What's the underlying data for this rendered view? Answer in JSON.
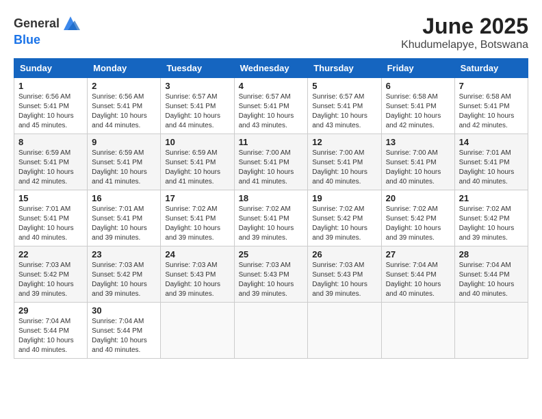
{
  "header": {
    "logo_general": "General",
    "logo_blue": "Blue",
    "month_title": "June 2025",
    "location": "Khudumelapye, Botswana"
  },
  "columns": [
    "Sunday",
    "Monday",
    "Tuesday",
    "Wednesday",
    "Thursday",
    "Friday",
    "Saturday"
  ],
  "weeks": [
    [
      {
        "day": "1",
        "sunrise": "6:56 AM",
        "sunset": "5:41 PM",
        "daylight": "10 hours and 45 minutes."
      },
      {
        "day": "2",
        "sunrise": "6:56 AM",
        "sunset": "5:41 PM",
        "daylight": "10 hours and 44 minutes."
      },
      {
        "day": "3",
        "sunrise": "6:57 AM",
        "sunset": "5:41 PM",
        "daylight": "10 hours and 44 minutes."
      },
      {
        "day": "4",
        "sunrise": "6:57 AM",
        "sunset": "5:41 PM",
        "daylight": "10 hours and 43 minutes."
      },
      {
        "day": "5",
        "sunrise": "6:57 AM",
        "sunset": "5:41 PM",
        "daylight": "10 hours and 43 minutes."
      },
      {
        "day": "6",
        "sunrise": "6:58 AM",
        "sunset": "5:41 PM",
        "daylight": "10 hours and 42 minutes."
      },
      {
        "day": "7",
        "sunrise": "6:58 AM",
        "sunset": "5:41 PM",
        "daylight": "10 hours and 42 minutes."
      }
    ],
    [
      {
        "day": "8",
        "sunrise": "6:59 AM",
        "sunset": "5:41 PM",
        "daylight": "10 hours and 42 minutes."
      },
      {
        "day": "9",
        "sunrise": "6:59 AM",
        "sunset": "5:41 PM",
        "daylight": "10 hours and 41 minutes."
      },
      {
        "day": "10",
        "sunrise": "6:59 AM",
        "sunset": "5:41 PM",
        "daylight": "10 hours and 41 minutes."
      },
      {
        "day": "11",
        "sunrise": "7:00 AM",
        "sunset": "5:41 PM",
        "daylight": "10 hours and 41 minutes."
      },
      {
        "day": "12",
        "sunrise": "7:00 AM",
        "sunset": "5:41 PM",
        "daylight": "10 hours and 40 minutes."
      },
      {
        "day": "13",
        "sunrise": "7:00 AM",
        "sunset": "5:41 PM",
        "daylight": "10 hours and 40 minutes."
      },
      {
        "day": "14",
        "sunrise": "7:01 AM",
        "sunset": "5:41 PM",
        "daylight": "10 hours and 40 minutes."
      }
    ],
    [
      {
        "day": "15",
        "sunrise": "7:01 AM",
        "sunset": "5:41 PM",
        "daylight": "10 hours and 40 minutes."
      },
      {
        "day": "16",
        "sunrise": "7:01 AM",
        "sunset": "5:41 PM",
        "daylight": "10 hours and 39 minutes."
      },
      {
        "day": "17",
        "sunrise": "7:02 AM",
        "sunset": "5:41 PM",
        "daylight": "10 hours and 39 minutes."
      },
      {
        "day": "18",
        "sunrise": "7:02 AM",
        "sunset": "5:41 PM",
        "daylight": "10 hours and 39 minutes."
      },
      {
        "day": "19",
        "sunrise": "7:02 AM",
        "sunset": "5:42 PM",
        "daylight": "10 hours and 39 minutes."
      },
      {
        "day": "20",
        "sunrise": "7:02 AM",
        "sunset": "5:42 PM",
        "daylight": "10 hours and 39 minutes."
      },
      {
        "day": "21",
        "sunrise": "7:02 AM",
        "sunset": "5:42 PM",
        "daylight": "10 hours and 39 minutes."
      }
    ],
    [
      {
        "day": "22",
        "sunrise": "7:03 AM",
        "sunset": "5:42 PM",
        "daylight": "10 hours and 39 minutes."
      },
      {
        "day": "23",
        "sunrise": "7:03 AM",
        "sunset": "5:42 PM",
        "daylight": "10 hours and 39 minutes."
      },
      {
        "day": "24",
        "sunrise": "7:03 AM",
        "sunset": "5:43 PM",
        "daylight": "10 hours and 39 minutes."
      },
      {
        "day": "25",
        "sunrise": "7:03 AM",
        "sunset": "5:43 PM",
        "daylight": "10 hours and 39 minutes."
      },
      {
        "day": "26",
        "sunrise": "7:03 AM",
        "sunset": "5:43 PM",
        "daylight": "10 hours and 39 minutes."
      },
      {
        "day": "27",
        "sunrise": "7:04 AM",
        "sunset": "5:44 PM",
        "daylight": "10 hours and 40 minutes."
      },
      {
        "day": "28",
        "sunrise": "7:04 AM",
        "sunset": "5:44 PM",
        "daylight": "10 hours and 40 minutes."
      }
    ],
    [
      {
        "day": "29",
        "sunrise": "7:04 AM",
        "sunset": "5:44 PM",
        "daylight": "10 hours and 40 minutes."
      },
      {
        "day": "30",
        "sunrise": "7:04 AM",
        "sunset": "5:44 PM",
        "daylight": "10 hours and 40 minutes."
      },
      null,
      null,
      null,
      null,
      null
    ]
  ],
  "labels": {
    "sunrise": "Sunrise:",
    "sunset": "Sunset:",
    "daylight": "Daylight:"
  }
}
